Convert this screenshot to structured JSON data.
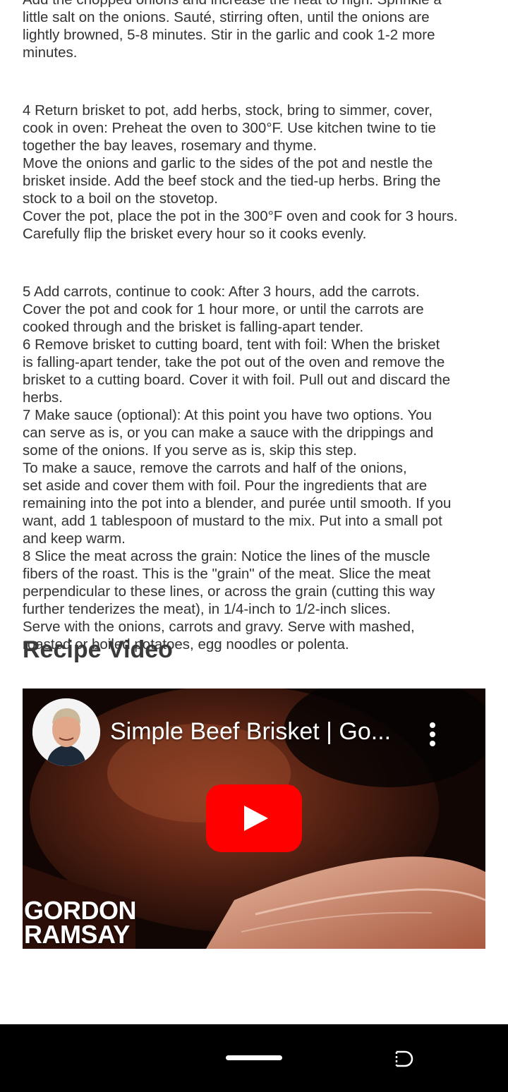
{
  "recipe": {
    "steps_text": [
      "Add the chopped onions and increase the heat to high. Sprinkle a",
      "little salt on the onions. Sauté, stirring often, until the onions are",
      "lightly browned, 5-8 minutes. Stir in the garlic and cook 1-2 more",
      "minutes.",
      "",
      "4 Return brisket to pot, add herbs, stock, bring to simmer, cover,",
      "cook in oven: Preheat the oven to 300°F. Use kitchen twine to tie",
      "together the bay leaves, rosemary and thyme.",
      "Move the onions and garlic to the sides of the pot and nestle the",
      "brisket inside. Add the beef stock and the tied-up herbs. Bring the",
      "stock to a boil on the stovetop.",
      "Cover the pot, place the pot in the 300°F oven and cook for 3 hours.",
      "Carefully flip the brisket every hour so it cooks evenly.",
      "",
      "5 Add carrots, continue to cook: After 3 hours, add the carrots.",
      "Cover the pot and cook for 1 hour more, or until the carrots are",
      "cooked through and the brisket is falling-apart tender.",
      "6 Remove brisket to cutting board, tent with foil: When the brisket",
      "is falling-apart tender, take the pot out of the oven and remove the",
      "brisket to a cutting board. Cover it with foil. Pull out and discard the",
      "herbs.",
      "7 Make sauce (optional): At this point you have two options. You",
      "can serve as is, or you can make a sauce with the drippings and",
      "some of the onions. If you serve as is, skip this step.",
      "To make a sauce, remove the carrots and half of the onions,",
      "set aside and cover them with foil. Pour the ingredients that are",
      "remaining into the pot into a blender, and purée until smooth. If you",
      "want, add 1 tablespoon of mustard to the mix. Put into a small pot",
      "and keep warm.",
      "8 Slice the meat across the grain: Notice the lines of the muscle",
      "fibers of the roast. This is the \"grain\" of the meat. Slice the meat",
      "perpendicular to these lines, or across the grain (cutting this way",
      "further tenderizes the meat), in 1/4-inch to 1/2-inch slices.",
      "Serve with the onions, carrots and gravy. Serve with mashed,",
      "roasted or boiled potatoes, egg noodles or polenta."
    ]
  },
  "video_section": {
    "title": "Recipe Video",
    "video": {
      "title": "Simple Beef Brisket | Go...",
      "brand_line1": "GORDON",
      "brand_line2": "RAMSAY",
      "play_icon": "youtube-play-icon",
      "menu_icon": "more-vertical-icon",
      "accent_color": "#ff0000"
    }
  },
  "system_nav": {
    "home_icon": "home-pill-icon",
    "rotate_icon": "rotate-screen-icon"
  }
}
